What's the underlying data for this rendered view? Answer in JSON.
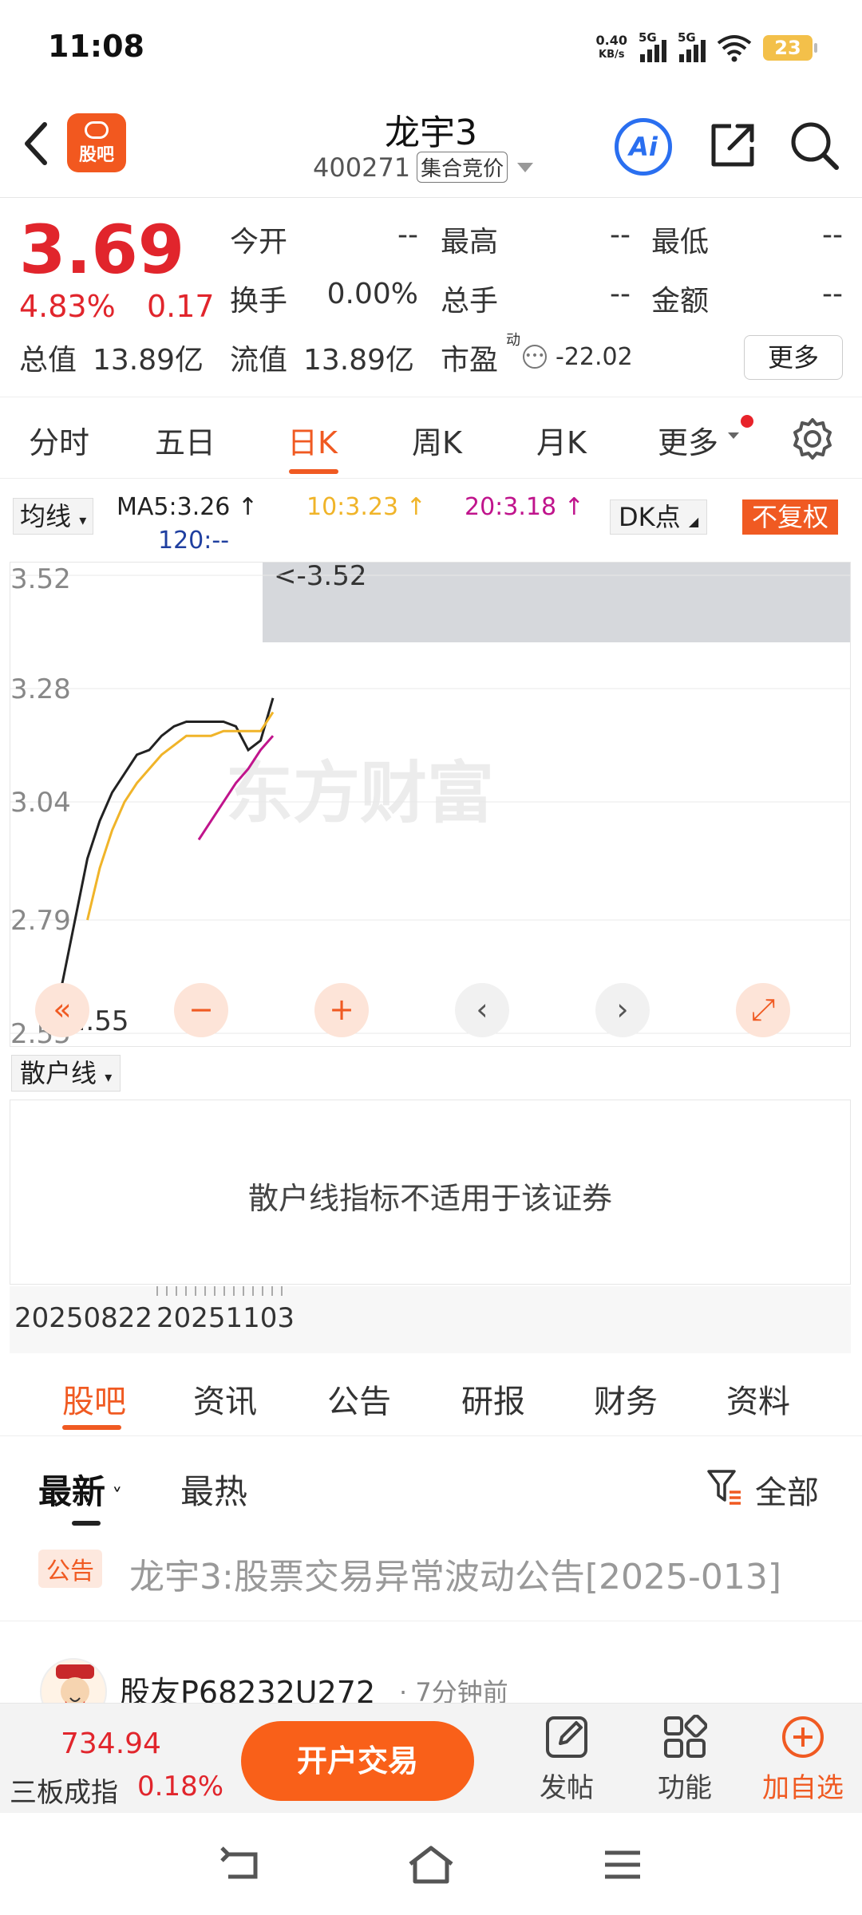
{
  "status": {
    "time": "11:08",
    "net_speed_value": "0.40",
    "net_speed_unit": "KB/s",
    "sim1": "5G",
    "sim2": "5G",
    "battery": "23"
  },
  "header": {
    "logo_text": "股吧",
    "stock_name": "龙宇3",
    "stock_code": "400271",
    "auction_tag": "集合竞价",
    "ai_label": "Ai"
  },
  "quote": {
    "price": "3.69",
    "change_pct": "4.83%",
    "change_amt": "0.17",
    "open_label": "今开",
    "open_value": "--",
    "high_label": "最高",
    "high_value": "--",
    "low_label": "最低",
    "low_value": "--",
    "turnover_label": "换手",
    "turnover_value": "0.00%",
    "volume_label": "总手",
    "volume_value": "--",
    "amount_label": "金额",
    "amount_value": "--",
    "mktcap_label": "总值",
    "mktcap_value": "13.89亿",
    "float_label": "流值",
    "float_value": "13.89亿",
    "pe_label": "市盈",
    "pe_sup": "动",
    "pe_value": "-22.02",
    "more_label": "更多"
  },
  "period_tabs": [
    "分时",
    "五日",
    "日K",
    "周K",
    "月K",
    "更多"
  ],
  "ma": {
    "select_label": "均线",
    "ma5": "MA5:3.26 ↑",
    "ma10": "10:3.23 ↑",
    "ma20": "20:3.18 ↑",
    "ma120": "120:--",
    "dk_label": "DK点",
    "fq_label": "不复权",
    "colors": {
      "ma5": "#222222",
      "ma10": "#f0b429",
      "ma20": "#c0148c",
      "ma120": "#1f3fa0"
    }
  },
  "chart_data": {
    "type": "line",
    "y_ticks": [
      "3.52",
      "3.28",
      "3.04",
      "2.79",
      "2.55"
    ],
    "ylim": [
      2.55,
      3.52
    ],
    "max_marker": "<-3.52",
    "min_marker": "<-2.55",
    "watermark": "东方财富",
    "x_labels": [
      "20250822",
      "20251103"
    ],
    "series": [
      {
        "name": "MA5",
        "color": "#222222",
        "x": [
          0,
          1,
          2,
          3,
          4,
          5,
          6,
          7,
          8,
          9,
          10,
          11,
          12,
          13,
          14,
          15,
          16,
          17,
          18
        ],
        "values": [
          2.55,
          2.66,
          2.79,
          2.92,
          3.0,
          3.06,
          3.1,
          3.14,
          3.15,
          3.18,
          3.2,
          3.21,
          3.21,
          3.21,
          3.21,
          3.2,
          3.15,
          3.17,
          3.26
        ]
      },
      {
        "name": "10",
        "color": "#f0b429",
        "x": [
          3,
          4,
          5,
          6,
          7,
          8,
          9,
          10,
          11,
          12,
          13,
          14,
          15,
          16,
          17,
          18
        ],
        "values": [
          2.79,
          2.9,
          2.98,
          3.04,
          3.08,
          3.11,
          3.14,
          3.16,
          3.18,
          3.18,
          3.18,
          3.19,
          3.19,
          3.19,
          3.19,
          3.23
        ]
      },
      {
        "name": "20",
        "color": "#c0148c",
        "x": [
          12,
          13,
          14,
          15,
          16,
          17,
          18
        ],
        "values": [
          2.96,
          3.0,
          3.04,
          3.08,
          3.11,
          3.15,
          3.18
        ]
      }
    ],
    "extra_labels": [
      "<-3.52",
      "<-2.55"
    ]
  },
  "retail": {
    "select_label": "散户线",
    "message": "散户线指标不适用于该证券"
  },
  "section_tabs": [
    "股吧",
    "资讯",
    "公告",
    "研报",
    "财务",
    "资料"
  ],
  "feed_filter": {
    "latest": "最新",
    "hot": "最热",
    "all": "全部"
  },
  "notice": {
    "tag": "公告",
    "text": "龙宇3:股票交易异常波动公告[2025-013]"
  },
  "post": {
    "user": "股友P68232U272",
    "time": "· 7分钟前"
  },
  "bottom_bar": {
    "index_value": "734.94",
    "index_name": "三板成指",
    "index_pct": "0.18%",
    "open_account": "开户交易",
    "post_label": "发帖",
    "func_label": "功能",
    "watch_label": "加自选"
  }
}
